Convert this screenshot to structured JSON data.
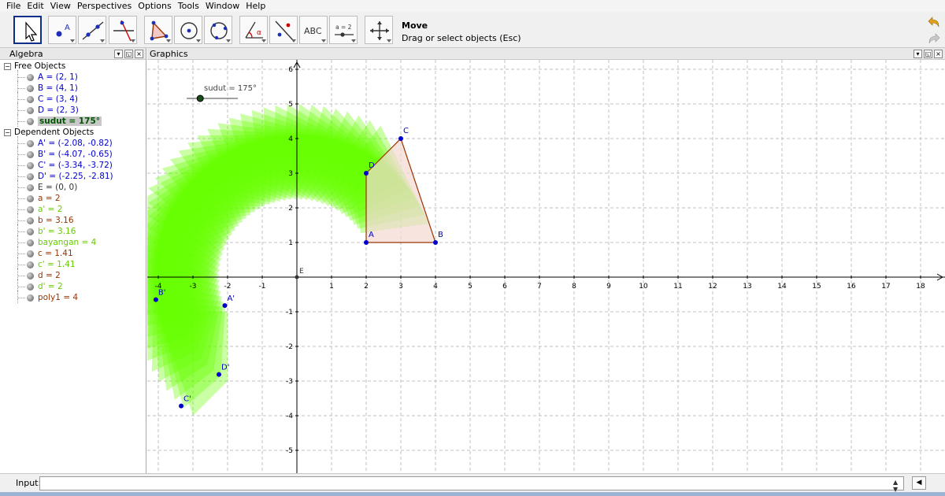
{
  "menu": [
    "File",
    "Edit",
    "View",
    "Perspectives",
    "Options",
    "Tools",
    "Window",
    "Help"
  ],
  "toolbar": {
    "tools": [
      "move-tool",
      "point-tool",
      "line-tool",
      "perpendicular-line-tool",
      "polygon-tool",
      "circle-with-center-tool",
      "circle-through-points-tool",
      "angle-tool",
      "reflect-about-line-tool",
      "text-tool",
      "slider-tool",
      "move-graphics-view-tool"
    ],
    "selected_tool": "move-tool",
    "text_tool_label": "ABC",
    "slider_tool_label": "a = 2",
    "tool_name": "Move",
    "tool_help": "Drag or select objects (Esc)"
  },
  "algebra": {
    "title": "Algebra",
    "groups": [
      {
        "label": "Free Objects",
        "items": [
          {
            "text": "A = (2, 1)",
            "color": "#0000cc"
          },
          {
            "text": "B = (4, 1)",
            "color": "#0000cc"
          },
          {
            "text": "C = (3, 4)",
            "color": "#0000cc"
          },
          {
            "text": "D = (2, 3)",
            "color": "#0000cc"
          },
          {
            "text": "sudut = 175°",
            "color": "#005500",
            "selected": true
          }
        ]
      },
      {
        "label": "Dependent Objects",
        "items": [
          {
            "text": "A' = (-2.08, -0.82)",
            "color": "#0000cc"
          },
          {
            "text": "B' = (-4.07, -0.65)",
            "color": "#0000cc"
          },
          {
            "text": "C' = (-3.34, -3.72)",
            "color": "#0000cc"
          },
          {
            "text": "D' = (-2.25, -2.81)",
            "color": "#0000cc"
          },
          {
            "text": "E = (0, 0)",
            "color": "#333333"
          },
          {
            "text": "a = 2",
            "color": "#993300"
          },
          {
            "text": "a' = 2",
            "color": "#66cc00"
          },
          {
            "text": "b = 3.16",
            "color": "#993300"
          },
          {
            "text": "b' = 3.16",
            "color": "#66cc00"
          },
          {
            "text": "bayangan = 4",
            "color": "#66cc00"
          },
          {
            "text": "c = 1.41",
            "color": "#993300"
          },
          {
            "text": "c' = 1.41",
            "color": "#66cc00"
          },
          {
            "text": "d = 2",
            "color": "#993300"
          },
          {
            "text": "d' = 2",
            "color": "#66cc00"
          },
          {
            "text": "poly1 = 4",
            "color": "#993300"
          }
        ]
      }
    ]
  },
  "graphics": {
    "title": "Graphics",
    "slider_label": "sudut = 175°",
    "slider_value_deg": 175,
    "x_ticks": [
      "-4",
      "-3",
      "-2",
      "-1",
      "0",
      "1",
      "2",
      "3",
      "4",
      "5",
      "6",
      "7",
      "8",
      "9",
      "10",
      "11",
      "12",
      "13",
      "14",
      "15",
      "16",
      "17",
      "18"
    ],
    "y_ticks": [
      "-5",
      "-4",
      "-3",
      "-2",
      "-1",
      "1",
      "2",
      "3",
      "4",
      "5",
      "6"
    ],
    "origin_label": "E",
    "polygon": {
      "color": "#993300",
      "fill": "#f4d9d2",
      "points": [
        {
          "name": "A",
          "x": 2,
          "y": 1
        },
        {
          "name": "B",
          "x": 4,
          "y": 1
        },
        {
          "name": "C",
          "x": 3,
          "y": 4
        },
        {
          "name": "D",
          "x": 2,
          "y": 3
        }
      ]
    },
    "image_points": [
      {
        "name": "A'",
        "x": -2.08,
        "y": -0.82
      },
      {
        "name": "B'",
        "x": -4.07,
        "y": -0.65
      },
      {
        "name": "C'",
        "x": -3.34,
        "y": -3.72
      },
      {
        "name": "D'",
        "x": -2.25,
        "y": -2.81
      }
    ],
    "trace_color": "#66ff00"
  },
  "input": {
    "label": "Input:",
    "value": "",
    "help_icon": "keyboard-toggle-icon"
  }
}
